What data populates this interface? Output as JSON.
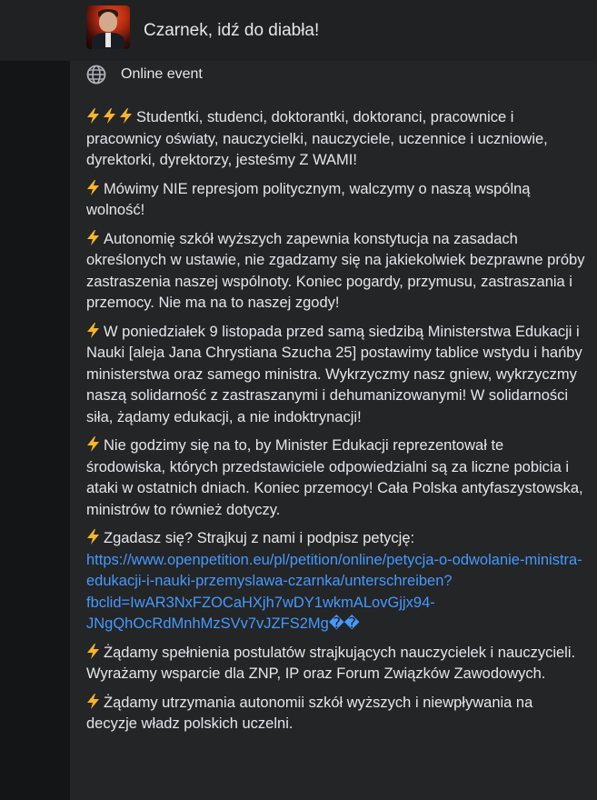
{
  "header": {
    "title": "Czarnek, idź do diabła!"
  },
  "event": {
    "type_label": "Online event",
    "type_icon": "globe-icon"
  },
  "colors": {
    "background": "#18191a",
    "panel": "#242526",
    "text": "#e4e6eb",
    "link": "#4599ff",
    "bolt": "#f7b52c"
  },
  "description": {
    "p1": "Studentki, studenci, doktorantki, doktoranci, pracownice i pracownicy oświaty, nauczycielki, nauczyciele, uczennice i uczniowie, dyrektorki, dyrektorzy, jesteśmy Z WAMI!",
    "p2": "Mówimy NIE represjom politycznym, walczymy o naszą wspólną wolność!",
    "p3": "Autonomię szkół wyższych zapewnia konstytucja na zasadach określonych w ustawie, nie zgadzamy się na jakiekolwiek bezprawne próby zastraszenia naszej wspólnoty. Koniec pogardy, przymusu, zastraszania i przemocy. Nie ma na to naszej zgody!",
    "p4": "W poniedziałek 9 listopada przed samą siedzibą Ministerstwa Edukacji i Nauki [aleja Jana Chrystiana Szucha 25] postawimy tablice wstydu i hańby ministerstwa oraz samego ministra. Wykrzyczmy nasz gniew, wykrzyczmy naszą solidarność z zastraszanymi i dehumanizowanymi! W solidarności siła, żądamy edukacji, a nie indoktrynacji!",
    "p5": "Nie godzimy się na to, by Minister Edukacji reprezentował te środowiska, których przedstawiciele odpowiedzialni są za liczne pobicia i ataki w ostatnich dniach. Koniec przemocy! Cała Polska antyfaszystowska, ministrów to również dotyczy.",
    "p6_text": "Zgadasz się? Strajkuj z nami i podpisz petycję:",
    "p6_link": "https://www.openpetition.eu/pl/petition/online/petycja-o-odwolanie-ministra-edukacji-i-nauki-przemyslawa-czarnka/unterschreiben?fbclid=IwAR3NxFZOCaHXjh7wDY1wkmALovGjjx94-JNgQhOcRdMnhMzSVv7vJZFS2Mg��",
    "p7": "Żądamy spełnienia postulatów strajkujących nauczycielek i nauczycieli. Wyrażamy wsparcie dla ZNP, IP oraz Forum Związków Zawodowych.",
    "p8": "Żądamy utrzymania autonomii szkół wyższych i niewpływania na decyzje władz polskich uczelni."
  }
}
